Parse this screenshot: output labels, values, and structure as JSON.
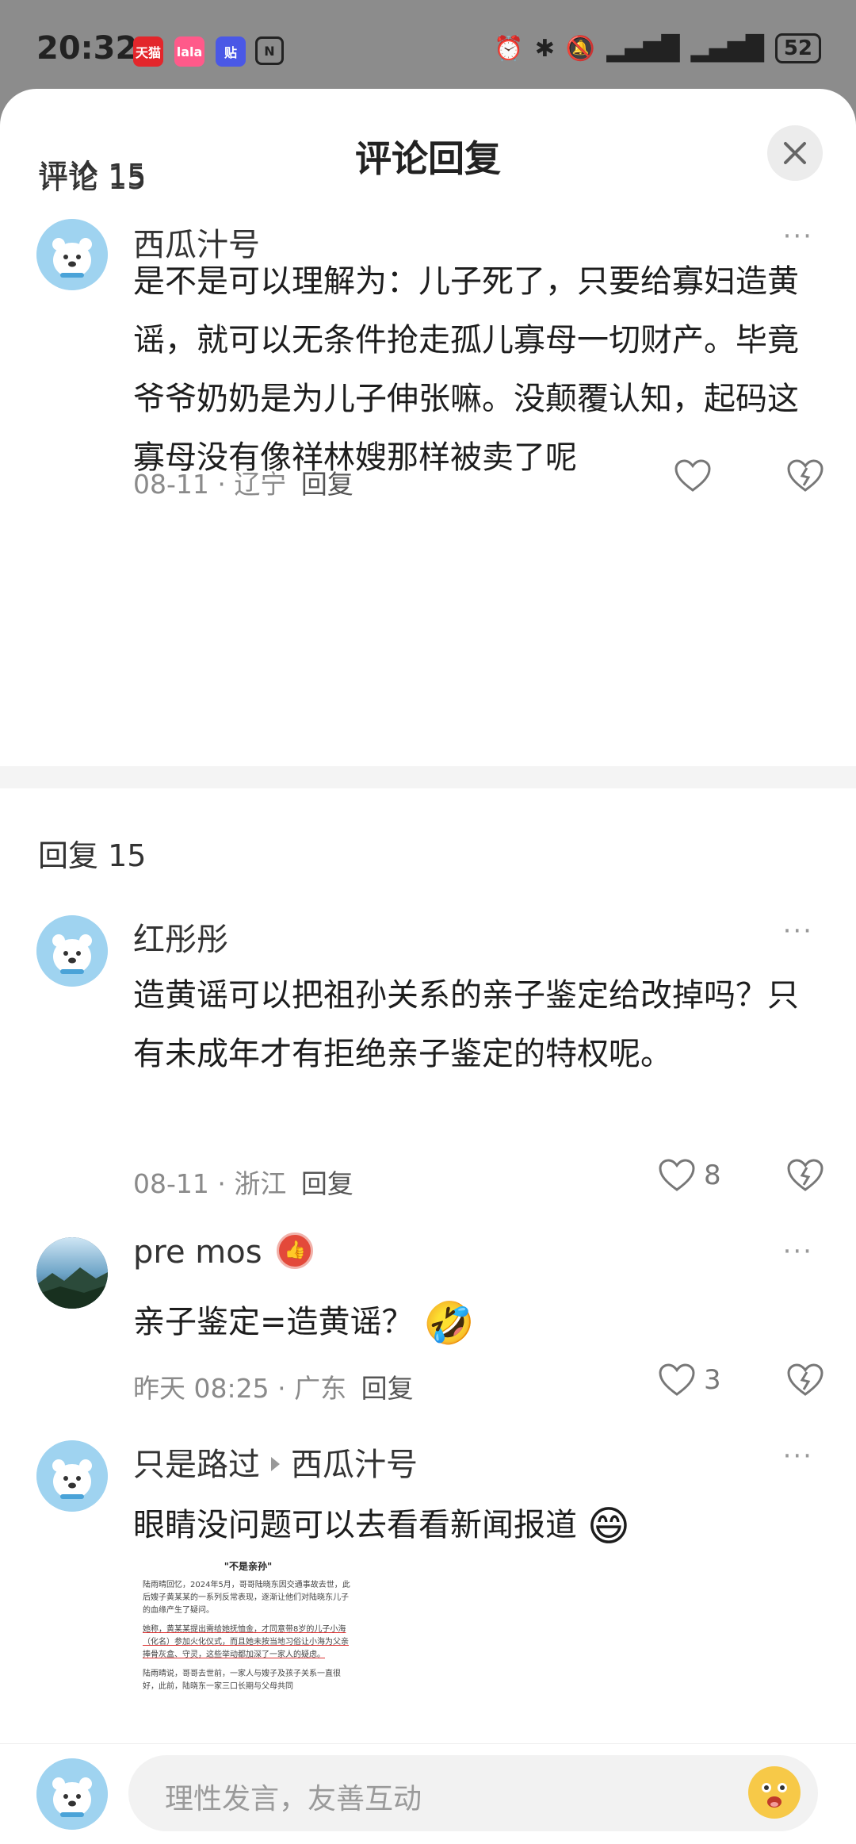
{
  "status_bar": {
    "time": "20:32",
    "apps": [
      {
        "name": "tmall-icon",
        "label": "天猫",
        "color": "#e3262b"
      },
      {
        "name": "lala-icon",
        "label": "lala",
        "color": "#ff5a8a"
      },
      {
        "name": "tieba-icon",
        "label": "贴",
        "color": "#4a58e6"
      },
      {
        "name": "nfc-icon",
        "label": "N",
        "color": "#222222"
      }
    ],
    "battery": "52"
  },
  "sheet": {
    "title": "评论回复"
  },
  "sections": {
    "comments_label": "评论 15",
    "replies_label": "回复 15"
  },
  "main_comment": {
    "username": "西瓜汁号",
    "text": "是不是可以理解为：儿子死了，只要给寡妇造黄谣，就可以无条件抢走孤儿寡母一切财产。毕竟爷爷奶奶是为儿子伸张嘛。没颠覆认知，起码这寡母没有像祥林嫂那样被卖了呢",
    "date": "08-11",
    "location": "辽宁",
    "reply_label": "回复"
  },
  "replies": [
    {
      "username": "红彤彤",
      "text": "造黄谣可以把祖孙关系的亲子鉴定给改掉吗？只有未成年才有拒绝亲子鉴定的特权呢。",
      "date": "08-11",
      "location": "浙江",
      "reply_label": "回复",
      "likes": "8"
    },
    {
      "username": "pre mos",
      "text": "亲子鉴定=造黄谣？",
      "date": "昨天 08:25",
      "location": "广东",
      "reply_label": "回复",
      "likes": "3"
    },
    {
      "username": "只是路过",
      "reply_to": "西瓜汁号",
      "text": "眼睛没问题可以去看看新闻报道",
      "article": {
        "title": "\"不是亲孙\"",
        "p1": "陆雨晴回忆，2024年5月，哥哥陆晓东因交通事故去世，此后嫂子黄某某的一系列反常表现，逐渐让他们对陆晓东儿子的血缘产生了疑问。",
        "p2": "她称，黄某某提出需给她抚恤金，才同意带8岁的儿子小海（化名）参加火化仪式，而且她未按当地习俗让小海为父亲捧骨灰盒、守灵，这些举动都加深了一家人的疑虑。",
        "p3": "陆雨晴说，哥哥去世前，一家人与嫂子及孩子关系一直很好，此前，陆晓东一家三口长期与父母共同"
      }
    }
  ],
  "composer": {
    "placeholder": "理性发言，友善互动"
  },
  "more_label": "···"
}
